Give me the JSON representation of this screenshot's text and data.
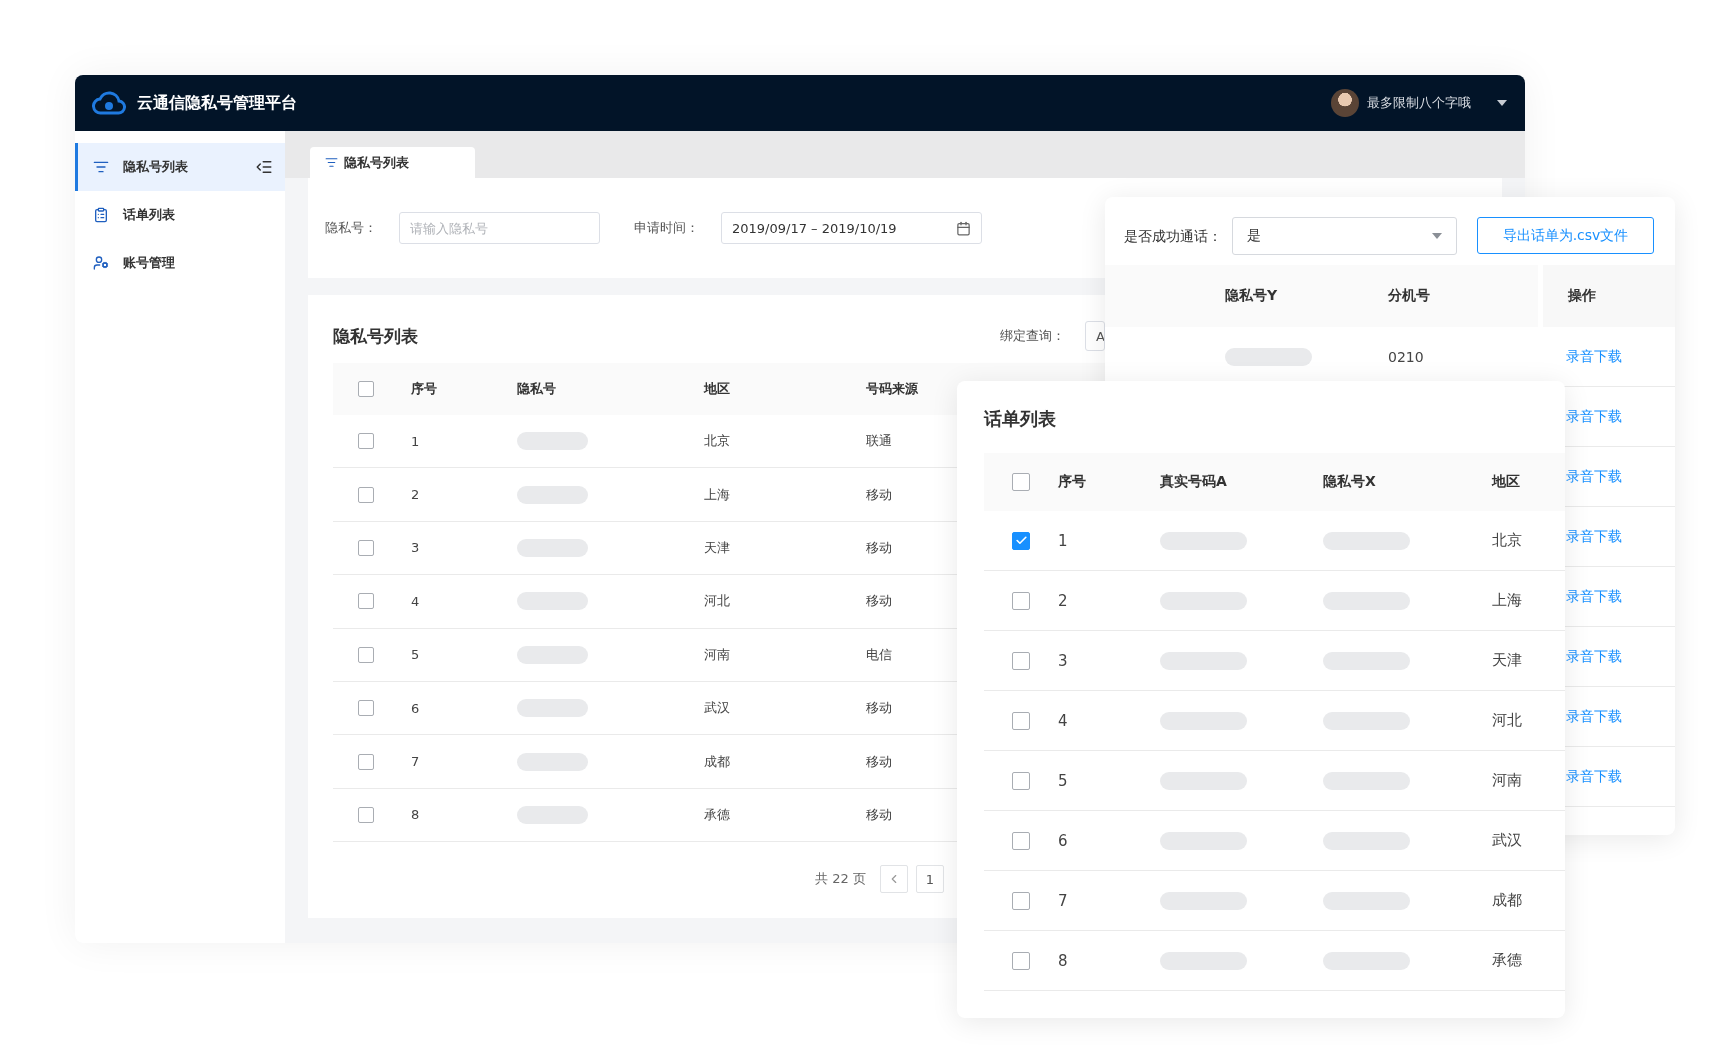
{
  "header": {
    "title": "云通信隐私号管理平台",
    "user_name": "最多限制八个字哦"
  },
  "sidebar": {
    "items": [
      {
        "label": "隐私号列表",
        "selected": true
      },
      {
        "label": "话单列表",
        "selected": false
      },
      {
        "label": "账号管理",
        "selected": false
      }
    ]
  },
  "tabs": [
    {
      "label": "隐私号列表",
      "selected": true
    }
  ],
  "filters": {
    "privacy_number": {
      "label": "隐私号：",
      "placeholder": "请输入隐私号"
    },
    "apply_time": {
      "label": "申请时间：",
      "value": "2019/09/17 – 2019/10/19"
    }
  },
  "number_list": {
    "title": "隐私号列表",
    "binding_query": {
      "label": "绑定查询：",
      "value": "A"
    },
    "select_all_checked": false,
    "columns": [
      "序号",
      "隐私号",
      "地区",
      "号码来源"
    ],
    "rows": [
      {
        "index": "1",
        "region": "北京",
        "source": "联通",
        "checked": false
      },
      {
        "index": "2",
        "region": "上海",
        "source": "移动",
        "checked": false
      },
      {
        "index": "3",
        "region": "天津",
        "source": "移动",
        "checked": false
      },
      {
        "index": "4",
        "region": "河北",
        "source": "移动",
        "checked": false
      },
      {
        "index": "5",
        "region": "河南",
        "source": "电信",
        "checked": false
      },
      {
        "index": "6",
        "region": "武汉",
        "source": "移动",
        "checked": false
      },
      {
        "index": "7",
        "region": "成都",
        "source": "移动",
        "checked": false
      },
      {
        "index": "8",
        "region": "承德",
        "source": "移动",
        "checked": false
      }
    ],
    "pagination": {
      "total": "共 22 页",
      "page": "1"
    }
  },
  "export_panel": {
    "success_filter": {
      "label": "是否成功通话：",
      "value": "是"
    },
    "export_button": "导出话单为.csv文件",
    "columns": [
      "隐私号Y",
      "分机号",
      "操作"
    ],
    "rows": [
      {
        "extension": "0210",
        "action": "录音下载"
      },
      {
        "action": "录音下载"
      },
      {
        "action": "录音下载"
      },
      {
        "action": "录音下载"
      },
      {
        "action": "录音下载"
      },
      {
        "action": "录音下载"
      },
      {
        "action": "录音下载"
      },
      {
        "action": "录音下载"
      }
    ]
  },
  "call_list": {
    "title": "话单列表",
    "select_all_checked": false,
    "columns": [
      "序号",
      "真实号码A",
      "隐私号X",
      "地区"
    ],
    "rows": [
      {
        "index": "1",
        "region": "北京",
        "checked": true
      },
      {
        "index": "2",
        "region": "上海",
        "checked": false
      },
      {
        "index": "3",
        "region": "天津",
        "checked": false
      },
      {
        "index": "4",
        "region": "河北",
        "checked": false
      },
      {
        "index": "5",
        "region": "河南",
        "checked": false
      },
      {
        "index": "6",
        "region": "武汉",
        "checked": false
      },
      {
        "index": "7",
        "region": "成都",
        "checked": false
      },
      {
        "index": "8",
        "region": "承德",
        "checked": false
      }
    ]
  }
}
